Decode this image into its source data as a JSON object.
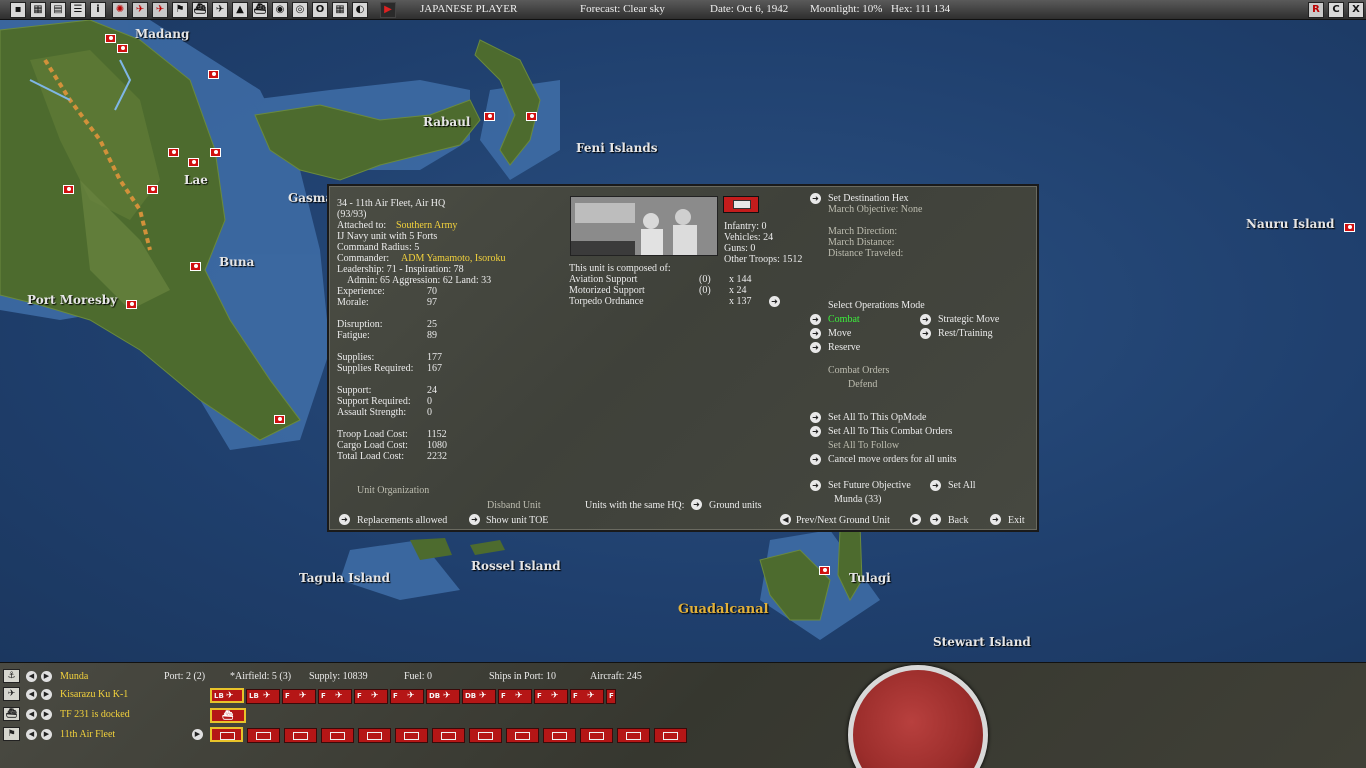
{
  "topbar": {
    "player": "JAPANESE PLAYER",
    "forecast": "Forecast: Clear sky",
    "date": "Date: Oct 6, 1942",
    "moonlight": "Moonlight: 10%",
    "hex": "Hex: 111  134",
    "right_buttons": [
      "R",
      "C",
      "X"
    ]
  },
  "map_labels": {
    "madang": "Madang",
    "rabaul": "Rabaul",
    "feni": "Feni Islands",
    "lae": "Lae",
    "gasmata": "Gasma",
    "buna": "Buna",
    "port_moresby": "Port Moresby",
    "nauru": "Nauru Island",
    "tagula": "Tagula Island",
    "rossel": "Rossel Island",
    "guadalcanal": "Guadalcanal",
    "tulagi": "Tulagi",
    "stewart": "Stewart Island"
  },
  "unit": {
    "title": "34 - 11th Air Fleet, Air HQ",
    "strength": "(93/93)",
    "attached_label": "Attached to:",
    "attached_value": "Southern Army",
    "navy_info": "IJ Navy unit with 5 Forts",
    "command_radius": "Command Radius: 5",
    "commander_label": "Commander:",
    "commander_value": "ADM Yamamoto, Isoroku",
    "leadership": "Leadership: 71 - Inspiration: 78",
    "admin": "Admin: 65  Aggression: 62  Land: 33",
    "stats": [
      {
        "label": "Experience:",
        "value": "70"
      },
      {
        "label": "Morale:",
        "value": "97"
      },
      {
        "label": "Disruption:",
        "value": "25"
      },
      {
        "label": "Fatigue:",
        "value": "89"
      },
      {
        "label": "Supplies:",
        "value": "177"
      },
      {
        "label": "Supplies Required:",
        "value": "167"
      },
      {
        "label": "Support:",
        "value": "24"
      },
      {
        "label": "Support Required:",
        "value": "0"
      },
      {
        "label": "Assault Strength:",
        "value": "0"
      },
      {
        "label": "Troop Load Cost:",
        "value": "1152"
      },
      {
        "label": "Cargo Load Cost:",
        "value": "1080"
      },
      {
        "label": "Total Load Cost:",
        "value": "2232"
      }
    ],
    "infantry": "Infantry: 0",
    "vehicles": "Vehicles: 24",
    "guns": "Guns: 0",
    "other_troops": "Other Troops: 1512",
    "composed_header": "This unit is composed of:",
    "composition": [
      {
        "name": "Aviation Support",
        "ready": "(0)",
        "count": "x 144"
      },
      {
        "name": "Motorized Support",
        "ready": "(0)",
        "count": "x 24"
      },
      {
        "name": "Torpedo Ordnance",
        "ready": "",
        "count": "x 137"
      }
    ],
    "unit_organization": "Unit Organization",
    "disband_unit": "Disband Unit",
    "replacements": "Replacements allowed",
    "show_toe": "Show unit TOE",
    "same_hq": "Units with the same HQ:",
    "ground_units": "Ground units",
    "set_destination": "Set Destination Hex",
    "march_objective": "March Objective: None",
    "march_direction": "March Direction:",
    "march_distance": "March Distance:",
    "distance_traveled": "Distance Traveled:",
    "ops_mode_header": "Select Operations Mode",
    "mode_combat": "Combat",
    "mode_strategic": "Strategic Move",
    "mode_move": "Move",
    "mode_rest": "Rest/Training",
    "mode_reserve": "Reserve",
    "combat_orders_header": "Combat Orders",
    "combat_orders_value": "Defend",
    "set_all_opmode": "Set All To This OpMode",
    "set_all_combat": "Set All To This Combat Orders",
    "set_all_follow": "Set All To Follow",
    "cancel_move": "Cancel move orders for all units",
    "set_future_objective": "Set Future Objective",
    "set_all": "Set All",
    "future_objective_value": "Munda (33)",
    "prev_next": "Prev/Next Ground Unit",
    "back": "Back",
    "exit": "Exit"
  },
  "bottom": {
    "base_name": "Munda",
    "port": "Port: 2 (2)",
    "airfield": "*Airfield: 5 (3)",
    "supply": "Supply: 10839",
    "fuel": "Fuel: 0",
    "ships_in_port": "Ships in Port: 10",
    "aircraft": "Aircraft: 245",
    "air_unit": "Kisarazu Ku K-1",
    "task_force": "TF 231 is docked",
    "hq_unit": "11th Air Fleet",
    "air_chips": [
      "LB",
      "LB",
      "F",
      "F",
      "F",
      "F",
      "DB",
      "DB",
      "F",
      "F",
      "F",
      "F"
    ]
  },
  "colors": {
    "japanese_red": "#c41c1c",
    "highlight_yellow": "#f3d23c",
    "active_green": "#3cf03c",
    "ocean": "#1f3f6d",
    "land": "#4d6b2e"
  }
}
